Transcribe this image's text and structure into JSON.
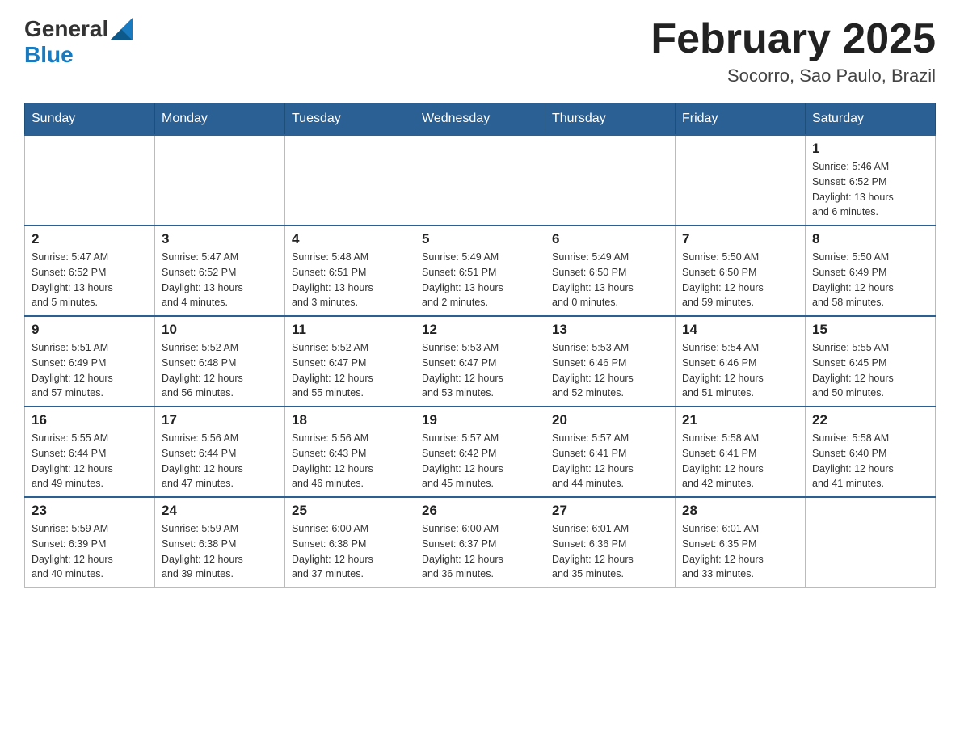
{
  "header": {
    "logo_general": "General",
    "logo_blue": "Blue",
    "month_year": "February 2025",
    "location": "Socorro, Sao Paulo, Brazil"
  },
  "weekdays": [
    "Sunday",
    "Monday",
    "Tuesday",
    "Wednesday",
    "Thursday",
    "Friday",
    "Saturday"
  ],
  "weeks": [
    [
      {
        "day": "",
        "info": ""
      },
      {
        "day": "",
        "info": ""
      },
      {
        "day": "",
        "info": ""
      },
      {
        "day": "",
        "info": ""
      },
      {
        "day": "",
        "info": ""
      },
      {
        "day": "",
        "info": ""
      },
      {
        "day": "1",
        "info": "Sunrise: 5:46 AM\nSunset: 6:52 PM\nDaylight: 13 hours\nand 6 minutes."
      }
    ],
    [
      {
        "day": "2",
        "info": "Sunrise: 5:47 AM\nSunset: 6:52 PM\nDaylight: 13 hours\nand 5 minutes."
      },
      {
        "day": "3",
        "info": "Sunrise: 5:47 AM\nSunset: 6:52 PM\nDaylight: 13 hours\nand 4 minutes."
      },
      {
        "day": "4",
        "info": "Sunrise: 5:48 AM\nSunset: 6:51 PM\nDaylight: 13 hours\nand 3 minutes."
      },
      {
        "day": "5",
        "info": "Sunrise: 5:49 AM\nSunset: 6:51 PM\nDaylight: 13 hours\nand 2 minutes."
      },
      {
        "day": "6",
        "info": "Sunrise: 5:49 AM\nSunset: 6:50 PM\nDaylight: 13 hours\nand 0 minutes."
      },
      {
        "day": "7",
        "info": "Sunrise: 5:50 AM\nSunset: 6:50 PM\nDaylight: 12 hours\nand 59 minutes."
      },
      {
        "day": "8",
        "info": "Sunrise: 5:50 AM\nSunset: 6:49 PM\nDaylight: 12 hours\nand 58 minutes."
      }
    ],
    [
      {
        "day": "9",
        "info": "Sunrise: 5:51 AM\nSunset: 6:49 PM\nDaylight: 12 hours\nand 57 minutes."
      },
      {
        "day": "10",
        "info": "Sunrise: 5:52 AM\nSunset: 6:48 PM\nDaylight: 12 hours\nand 56 minutes."
      },
      {
        "day": "11",
        "info": "Sunrise: 5:52 AM\nSunset: 6:47 PM\nDaylight: 12 hours\nand 55 minutes."
      },
      {
        "day": "12",
        "info": "Sunrise: 5:53 AM\nSunset: 6:47 PM\nDaylight: 12 hours\nand 53 minutes."
      },
      {
        "day": "13",
        "info": "Sunrise: 5:53 AM\nSunset: 6:46 PM\nDaylight: 12 hours\nand 52 minutes."
      },
      {
        "day": "14",
        "info": "Sunrise: 5:54 AM\nSunset: 6:46 PM\nDaylight: 12 hours\nand 51 minutes."
      },
      {
        "day": "15",
        "info": "Sunrise: 5:55 AM\nSunset: 6:45 PM\nDaylight: 12 hours\nand 50 minutes."
      }
    ],
    [
      {
        "day": "16",
        "info": "Sunrise: 5:55 AM\nSunset: 6:44 PM\nDaylight: 12 hours\nand 49 minutes."
      },
      {
        "day": "17",
        "info": "Sunrise: 5:56 AM\nSunset: 6:44 PM\nDaylight: 12 hours\nand 47 minutes."
      },
      {
        "day": "18",
        "info": "Sunrise: 5:56 AM\nSunset: 6:43 PM\nDaylight: 12 hours\nand 46 minutes."
      },
      {
        "day": "19",
        "info": "Sunrise: 5:57 AM\nSunset: 6:42 PM\nDaylight: 12 hours\nand 45 minutes."
      },
      {
        "day": "20",
        "info": "Sunrise: 5:57 AM\nSunset: 6:41 PM\nDaylight: 12 hours\nand 44 minutes."
      },
      {
        "day": "21",
        "info": "Sunrise: 5:58 AM\nSunset: 6:41 PM\nDaylight: 12 hours\nand 42 minutes."
      },
      {
        "day": "22",
        "info": "Sunrise: 5:58 AM\nSunset: 6:40 PM\nDaylight: 12 hours\nand 41 minutes."
      }
    ],
    [
      {
        "day": "23",
        "info": "Sunrise: 5:59 AM\nSunset: 6:39 PM\nDaylight: 12 hours\nand 40 minutes."
      },
      {
        "day": "24",
        "info": "Sunrise: 5:59 AM\nSunset: 6:38 PM\nDaylight: 12 hours\nand 39 minutes."
      },
      {
        "day": "25",
        "info": "Sunrise: 6:00 AM\nSunset: 6:38 PM\nDaylight: 12 hours\nand 37 minutes."
      },
      {
        "day": "26",
        "info": "Sunrise: 6:00 AM\nSunset: 6:37 PM\nDaylight: 12 hours\nand 36 minutes."
      },
      {
        "day": "27",
        "info": "Sunrise: 6:01 AM\nSunset: 6:36 PM\nDaylight: 12 hours\nand 35 minutes."
      },
      {
        "day": "28",
        "info": "Sunrise: 6:01 AM\nSunset: 6:35 PM\nDaylight: 12 hours\nand 33 minutes."
      },
      {
        "day": "",
        "info": ""
      }
    ]
  ]
}
